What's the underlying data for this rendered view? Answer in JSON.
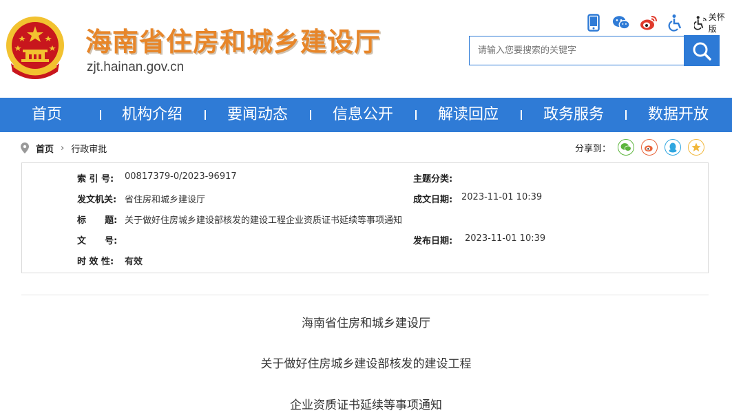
{
  "header": {
    "site_title": "海南省住房和城乡建设厅",
    "site_url": "zjt.hainan.gov.cn",
    "care_mode": "关怀版",
    "search_placeholder": "请输入您要搜索的关键字",
    "icons": [
      "mobile-icon",
      "wechat-icon",
      "weibo-icon",
      "accessibility-icon",
      "care-mode-icon"
    ]
  },
  "nav": {
    "items": [
      "首页",
      "机构介绍",
      "要闻动态",
      "信息公开",
      "解读回应",
      "政务服务",
      "数据开放"
    ]
  },
  "breadcrumb": {
    "home": "首页",
    "current": "行政审批"
  },
  "share": {
    "label": "分享到：",
    "icons": [
      "wechat",
      "weibo",
      "qq",
      "qzone"
    ]
  },
  "meta": {
    "index_label": "索  引 号:",
    "index_value": "00817379-0/2023-96917",
    "topic_label": "主题分类:",
    "topic_value": "",
    "issuer_label": "发文机关:",
    "issuer_value": "省住房和城乡建设厅",
    "written_label": "成文日期:",
    "written_value": "2023-11-01 10:39",
    "title_label": "标      题:",
    "title_value": "关于做好住房城乡建设部核发的建设工程企业资质证书延续等事项通知",
    "docno_label": "文      号:",
    "docno_value": "",
    "published_label": "发布日期:",
    "published_value": "2023-11-01 10:39",
    "validity_label": "时 效 性:",
    "validity_value": "有效"
  },
  "article": {
    "line1": "海南省住房和城乡建设厅",
    "line2": "关于做好住房城乡建设部核发的建设工程",
    "line3": "企业资质证书延续等事项通知"
  },
  "colors": {
    "primary": "#2f7bd6",
    "title_orange": "#e7862a",
    "emblem_red": "#c8161d",
    "emblem_gold": "#f2c230"
  }
}
